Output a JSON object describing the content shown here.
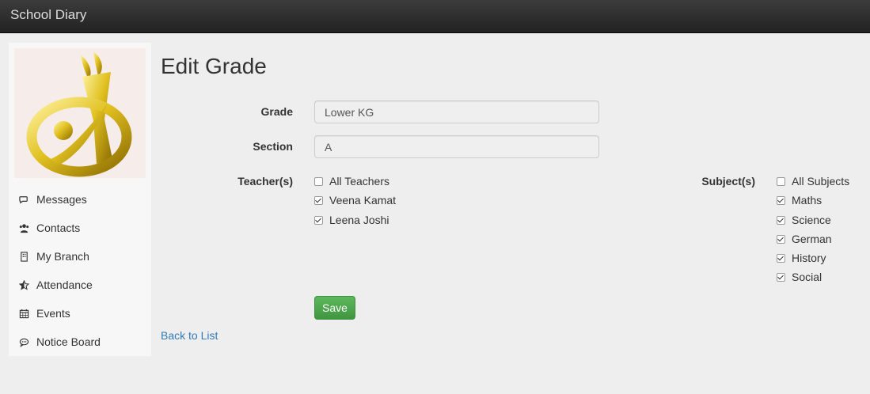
{
  "app": {
    "brand": "School Diary"
  },
  "sidebar": {
    "items": [
      {
        "icon": "comments-icon",
        "label": "Messages"
      },
      {
        "icon": "users-icon",
        "label": "Contacts"
      },
      {
        "icon": "building-icon",
        "label": "My Branch"
      },
      {
        "icon": "star-half-icon",
        "label": "Attendance"
      },
      {
        "icon": "calendar-icon",
        "label": "Events"
      },
      {
        "icon": "comment-icon",
        "label": "Notice Board"
      }
    ]
  },
  "page": {
    "title": "Edit Grade"
  },
  "form": {
    "grade_label": "Grade",
    "grade_value": "Lower KG",
    "section_label": "Section",
    "section_value": "A",
    "teachers_label": "Teacher(s)",
    "teachers": [
      {
        "label": "All Teachers",
        "checked": false
      },
      {
        "label": "Veena Kamat",
        "checked": true
      },
      {
        "label": "Leena Joshi",
        "checked": true
      }
    ],
    "subjects_label": "Subject(s)",
    "subjects": [
      {
        "label": "All Subjects",
        "checked": false
      },
      {
        "label": "Maths",
        "checked": true
      },
      {
        "label": "Science",
        "checked": true
      },
      {
        "label": "German",
        "checked": true
      },
      {
        "label": "History",
        "checked": true
      },
      {
        "label": "Social",
        "checked": true
      }
    ],
    "save_label": "Save",
    "back_label": "Back to List"
  }
}
